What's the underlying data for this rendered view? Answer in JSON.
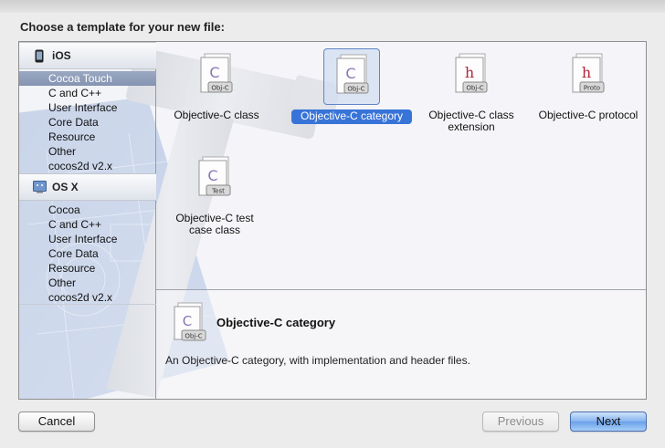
{
  "dialog": {
    "prompt": "Choose a template for your new file:"
  },
  "sidebar": {
    "groups": [
      {
        "title": "iOS",
        "icon": "iphone-icon",
        "items": [
          "Cocoa Touch",
          "C and C++",
          "User Interface",
          "Core Data",
          "Resource",
          "Other",
          "cocos2d v2.x"
        ],
        "selected_index": 0
      },
      {
        "title": "OS X",
        "icon": "finder-icon",
        "items": [
          "Cocoa",
          "C and C++",
          "User Interface",
          "Core Data",
          "Resource",
          "Other",
          "cocos2d v2.x"
        ]
      }
    ]
  },
  "templates": [
    {
      "label": "Objective-C class",
      "icon_badge": "Obj-C",
      "icon_letter": "C",
      "icon": "objc-class-file-icon"
    },
    {
      "label": "Objective-C category",
      "icon_badge": "Obj-C",
      "icon_letter": "C",
      "icon": "objc-category-file-icon",
      "selected": true
    },
    {
      "label": "Objective-C class extension",
      "icon_badge": "Obj-C",
      "icon_letter": "h",
      "icon": "objc-extension-file-icon"
    },
    {
      "label": "Objective-C protocol",
      "icon_badge": "Proto",
      "icon_letter": "h",
      "icon": "objc-protocol-file-icon"
    },
    {
      "label": "Objective-C test case class",
      "icon_badge": "Test",
      "icon_letter": "C",
      "icon": "objc-test-file-icon"
    }
  ],
  "detail": {
    "title": "Objective-C category",
    "description": "An Objective-C category, with implementation and header files.",
    "icon_badge": "Obj-C",
    "icon_letter": "C"
  },
  "buttons": {
    "cancel": "Cancel",
    "previous": "Previous",
    "next": "Next"
  },
  "colors": {
    "selection_blue": "#3874d8",
    "sidebar_selection": "#8e9db9",
    "c_letter": "#8a76b4",
    "h_letter": "#b2273a"
  }
}
